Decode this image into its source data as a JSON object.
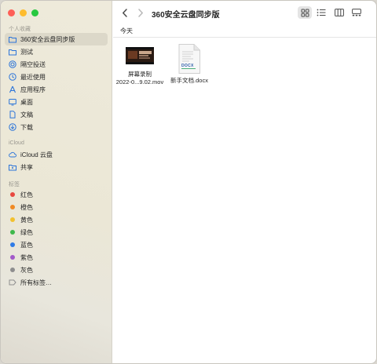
{
  "window": {
    "title": "360安全云盘同步版"
  },
  "sidebar": {
    "favorites_title": "个人收藏",
    "favorites": [
      {
        "label": "360安全云盘同步版",
        "icon": "folder-icon",
        "selected": true
      },
      {
        "label": "测试",
        "icon": "folder-icon"
      },
      {
        "label": "隔空投送",
        "icon": "airdrop-icon"
      },
      {
        "label": "最近使用",
        "icon": "clock-icon"
      },
      {
        "label": "应用程序",
        "icon": "applications-icon"
      },
      {
        "label": "桌面",
        "icon": "desktop-icon"
      },
      {
        "label": "文稿",
        "icon": "document-icon"
      },
      {
        "label": "下载",
        "icon": "download-icon"
      }
    ],
    "icloud_title": "iCloud",
    "icloud": [
      {
        "label": "iCloud 云盘",
        "icon": "cloud-icon"
      },
      {
        "label": "共享",
        "icon": "shared-folder-icon"
      }
    ],
    "tags_title": "标签",
    "tags": [
      {
        "label": "红色",
        "color": "#e8483f"
      },
      {
        "label": "橙色",
        "color": "#f08a24"
      },
      {
        "label": "黄色",
        "color": "#f2c12e"
      },
      {
        "label": "绿色",
        "color": "#3fb84c"
      },
      {
        "label": "蓝色",
        "color": "#2f7be6"
      },
      {
        "label": "紫色",
        "color": "#a259c9"
      },
      {
        "label": "灰色",
        "color": "#8e8e8e"
      }
    ],
    "all_tags": "所有标签…"
  },
  "main": {
    "group_label": "今天",
    "files": [
      {
        "name_line1": "屏幕录制",
        "name_line2": "2022-0...9.02.mov",
        "icon": "video-thumbnail-icon"
      },
      {
        "name_line1": "新手文档.docx",
        "name_line2": "",
        "icon": "docx-document-icon",
        "badge": "DOCX"
      }
    ]
  },
  "colors": {
    "accent": "#2b74d9",
    "close": "#fe5f57",
    "minimize": "#febc2e",
    "zoom": "#28c840"
  }
}
